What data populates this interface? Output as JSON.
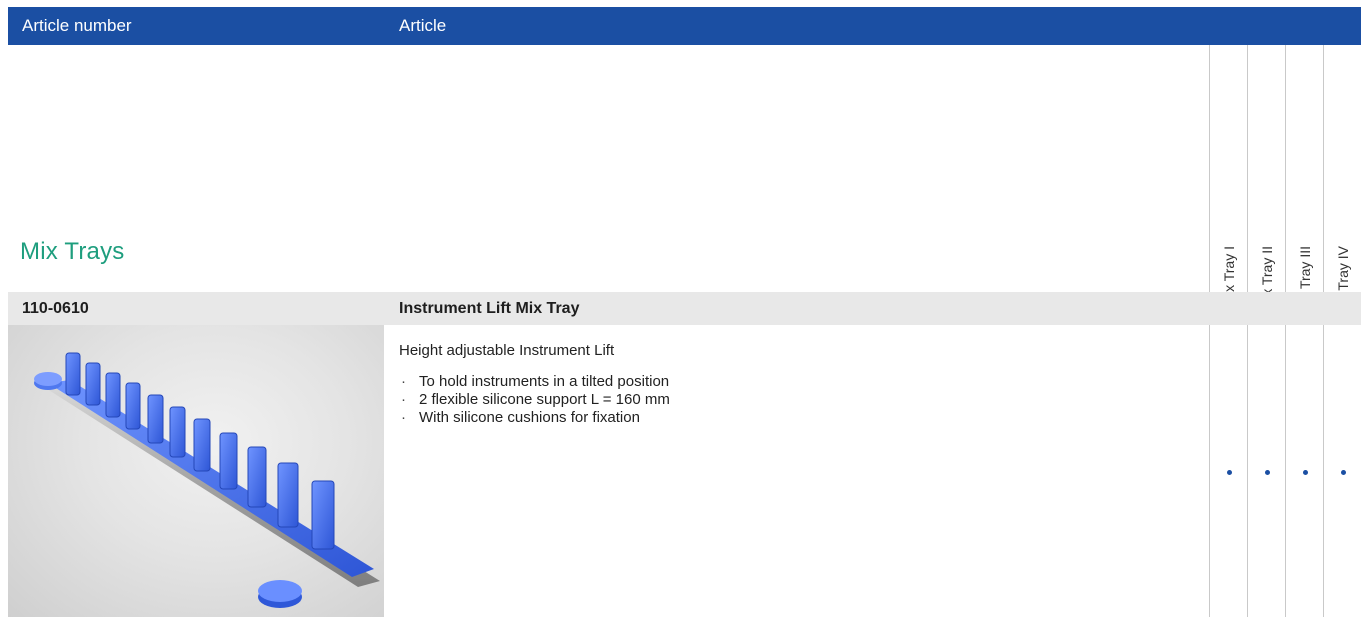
{
  "header": {
    "col_article_number": "Article number",
    "col_article": "Article"
  },
  "section": {
    "title": "Mix Trays"
  },
  "variant_columns": [
    {
      "label": "Mix Tray I",
      "included": true
    },
    {
      "label": "Mix Tray II",
      "included": true
    },
    {
      "label": "Mix Tray III",
      "included": true
    },
    {
      "label": "Mix Tray IV",
      "included": true
    }
  ],
  "product": {
    "code": "110-0610",
    "name": "Instrument Lift Mix Tray",
    "lead": "Height adjustable Instrument Lift",
    "features": [
      "To hold instruments in a tilted position",
      "2 flexible silicone support L = 160 mm",
      "With silicone cushions for fixation"
    ]
  },
  "colors": {
    "header_bg": "#1b4fa3",
    "section_title": "#1e9e7e",
    "row_band": "#e8e8e8",
    "dot": "#1b4fa3",
    "tray_blue": "#3f6fe0"
  }
}
